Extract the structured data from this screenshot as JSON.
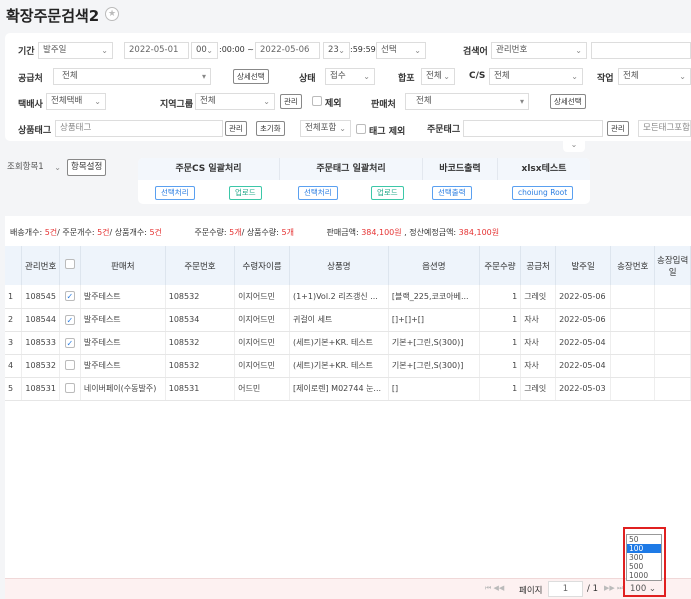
{
  "title": "확장주문검색2",
  "filters": {
    "period_label": "기간",
    "period_type": "발주일",
    "date_from": "2022-05-01",
    "hour_from": "00",
    "time_from": ":00:00 ~",
    "date_to": "2022-05-06",
    "hour_to": "23",
    "time_to": ":59:59",
    "period_preset": "선택",
    "search_label": "검색어",
    "search_type": "관리번호",
    "search_value": "",
    "supplier_label": "공급처",
    "supplier_value": "전체",
    "supplier_detail_btn": "상세선택",
    "status_label": "상태",
    "status_value": "접수",
    "merge_label": "합포",
    "merge_value": "전체",
    "cs_label": "C/S",
    "cs_value": "전체",
    "work_label": "작업",
    "work_value": "전체",
    "courier_label": "택배사",
    "courier_value": "전체택배",
    "region_label": "지역그룹",
    "region_value": "전체",
    "region_manage_btn": "관리",
    "exclude_label": "제외",
    "seller_label": "판매처",
    "seller_value": "전체",
    "seller_detail_btn": "상세선택",
    "product_tag_label": "상품태그",
    "product_tag_placeholder": "상품태그",
    "product_tag_manage_btn": "관리",
    "reset_btn": "초기화",
    "tag_include_value": "전체포함",
    "tag_exclude_label": "태그 제외",
    "order_tag_label": "주문태그",
    "order_tag_value": "",
    "order_tag_manage_btn": "관리",
    "order_tag_include_value": "모든태그포함"
  },
  "view": {
    "preset": "조회항목1",
    "settings_btn": "항목설정"
  },
  "batch": {
    "headers": [
      "주문CS 일괄처리",
      "주문태그 일괄처리",
      "바코드출력",
      "xlsx테스트"
    ],
    "buttons": [
      "선택처리",
      "업로드",
      "선택처리",
      "업로드",
      "선택출력",
      "choiung Root"
    ]
  },
  "summary": {
    "ship_label": "배송개수: ",
    "ship": "5건",
    "order_label": "/ 주문개수: ",
    "order": "5건",
    "prod_label": "/ 상품개수: ",
    "prod": "5건",
    "qty_label": "주문수량: ",
    "qty": "5개",
    "pqty_label": "/ 상품수량: ",
    "pqty": "5개",
    "sales_label": "판매금액: ",
    "sales": "384,100원",
    "settle_label": " , 정산예정금액: ",
    "settle": "384,100원"
  },
  "table": {
    "headers": [
      "",
      "관리번호",
      "",
      "판매처",
      "주문번호",
      "수령자이름",
      "상품명",
      "옵션명",
      "주문수량",
      "공급처",
      "발주일",
      "송장번호",
      "송장입력일"
    ],
    "rows": [
      [
        "1",
        "108545",
        true,
        "발주테스트",
        "108532",
        "이지어드민",
        "(1+1)Vol.2 리즈갱신 ...",
        "[블랙_225,코코아베...",
        "1",
        "그레잇",
        "2022-05-06",
        "",
        ""
      ],
      [
        "2",
        "108544",
        true,
        "발주테스트",
        "108534",
        "이지어드민",
        "귀걸이 세트",
        "[]+[]+[]",
        "1",
        "자사",
        "2022-05-06",
        "",
        ""
      ],
      [
        "3",
        "108533",
        true,
        "발주테스트",
        "108532",
        "이지어드민",
        "(세트)기본+KR. 테스트",
        "기본+[그린,S(300)]",
        "1",
        "자사",
        "2022-05-04",
        "",
        ""
      ],
      [
        "4",
        "108532",
        false,
        "발주테스트",
        "108532",
        "이지어드민",
        "(세트)기본+KR. 테스트",
        "기본+[그린,S(300)]",
        "1",
        "자사",
        "2022-05-04",
        "",
        ""
      ],
      [
        "5",
        "108531",
        false,
        "네이버페이(수동발주)",
        "108531",
        "어드민",
        "[제이로렌] M02744 눈...",
        "[]",
        "1",
        "그레잇",
        "2022-05-03",
        "",
        ""
      ]
    ]
  },
  "pager": {
    "page_label": "페이지",
    "page": "1",
    "total": "/ 1",
    "page_size": "100",
    "options": [
      "50",
      "100",
      "300",
      "500",
      "1000"
    ]
  }
}
